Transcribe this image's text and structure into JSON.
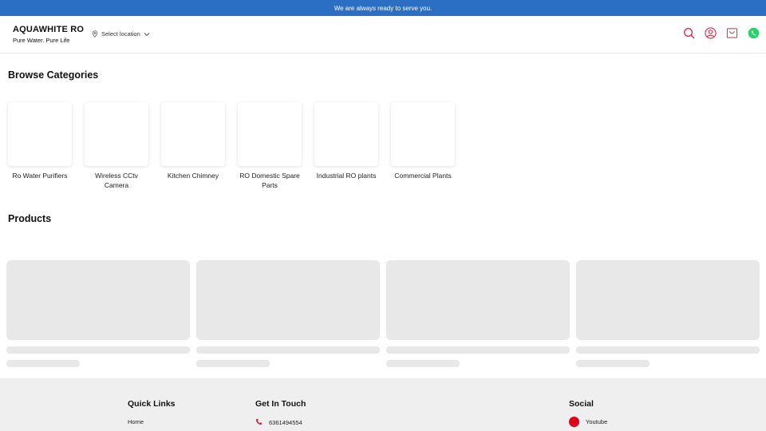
{
  "topbar": {
    "message": "We are always ready to serve you."
  },
  "header": {
    "brand_name": "AQUAWHITE RO",
    "tagline": "Pure Water. Pure Life",
    "location_label": "Select location",
    "icons": [
      "search-icon",
      "user-icon",
      "cart-icon",
      "whatsapp-icon"
    ]
  },
  "categories": {
    "title": "Browse Categories",
    "items": [
      {
        "label": "Ro Water Purifiers"
      },
      {
        "label": "Wireless CCtv Camera"
      },
      {
        "label": "Kitchen Chimney"
      },
      {
        "label": "RO Domestic Spare Parts"
      },
      {
        "label": "Industrial RO plants"
      },
      {
        "label": "Commercial Plants"
      }
    ]
  },
  "products": {
    "title": "Products",
    "placeholder_count": 4
  },
  "footer": {
    "quick_links": {
      "title": "Quick Links",
      "items": [
        "Home"
      ]
    },
    "get_in_touch": {
      "title": "Get In Touch",
      "phone": "6361494554"
    },
    "social": {
      "title": "Social",
      "items": [
        "Youtube"
      ]
    }
  },
  "colors": {
    "topbar": "#2a6fc4",
    "accent": "#d32f4a",
    "whatsapp": "#25d366",
    "youtube": "#e0001b"
  }
}
